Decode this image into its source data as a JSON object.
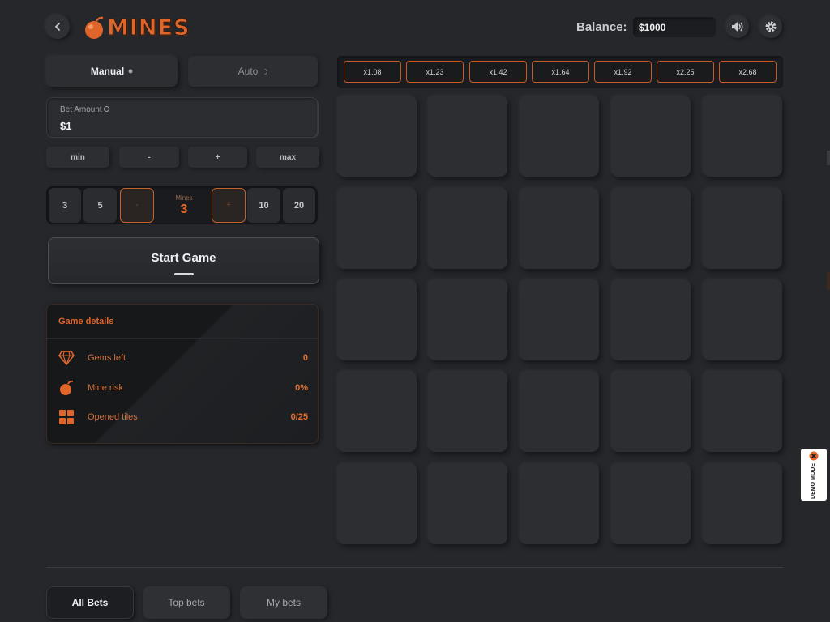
{
  "header": {
    "logo_text": "MINES",
    "balance_label": "Balance:",
    "balance_value": "$1000"
  },
  "mode_tabs": [
    {
      "label": "Manual",
      "active": true
    },
    {
      "label": "Auto",
      "active": false
    }
  ],
  "bet": {
    "label": "Bet Amount",
    "value": "$1",
    "quick": [
      "min",
      "-",
      "+",
      "max"
    ]
  },
  "mines": {
    "presets_left": [
      "3",
      "5"
    ],
    "presets_right": [
      "10",
      "20"
    ],
    "minus_label": "-",
    "plus_label": "+",
    "label": "Mines",
    "value": "3"
  },
  "start_button": {
    "label": "Start Game"
  },
  "game_details": {
    "title": "Game details",
    "rows": [
      {
        "icon": "gem-icon",
        "label": "Gems left",
        "value": "0"
      },
      {
        "icon": "bomb-icon",
        "label": "Mine risk",
        "value": "0%"
      },
      {
        "icon": "tiles-icon",
        "label": "Opened tiles",
        "value": "0/25"
      }
    ]
  },
  "multipliers": [
    "x1.08",
    "x1.23",
    "x1.42",
    "x1.64",
    "x1.92",
    "x2.25",
    "x2.68"
  ],
  "grid": {
    "rows": 5,
    "cols": 5
  },
  "bets_tabs": [
    {
      "label": "All Bets",
      "active": true
    },
    {
      "label": "Top bets",
      "active": false
    },
    {
      "label": "My bets",
      "active": false
    }
  ],
  "demo_badge": {
    "text": "DEMO MODE"
  },
  "colors": {
    "accent": "#e0652a",
    "background": "#25272b",
    "tile": "#2c2e32"
  }
}
